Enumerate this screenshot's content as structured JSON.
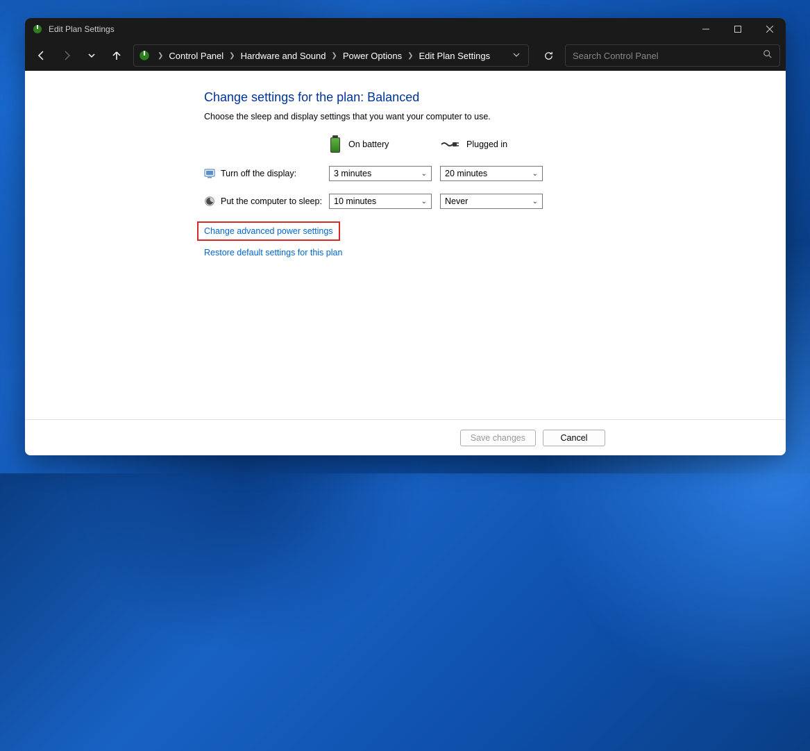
{
  "window": {
    "title": "Edit Plan Settings"
  },
  "breadcrumbs": {
    "items": [
      "Control Panel",
      "Hardware and Sound",
      "Power Options",
      "Edit Plan Settings"
    ]
  },
  "search": {
    "placeholder": "Search Control Panel"
  },
  "page": {
    "heading": "Change settings for the plan: Balanced",
    "subtext": "Choose the sleep and display settings that you want your computer to use.",
    "col_battery": "On battery",
    "col_plugged": "Plugged in",
    "settings": {
      "display_label": "Turn off the display:",
      "display_battery": "3 minutes",
      "display_plugged": "20 minutes",
      "sleep_label": "Put the computer to sleep:",
      "sleep_battery": "10 minutes",
      "sleep_plugged": "Never"
    },
    "links": {
      "advanced": "Change advanced power settings",
      "restore": "Restore default settings for this plan"
    },
    "buttons": {
      "save": "Save changes",
      "cancel": "Cancel"
    }
  }
}
